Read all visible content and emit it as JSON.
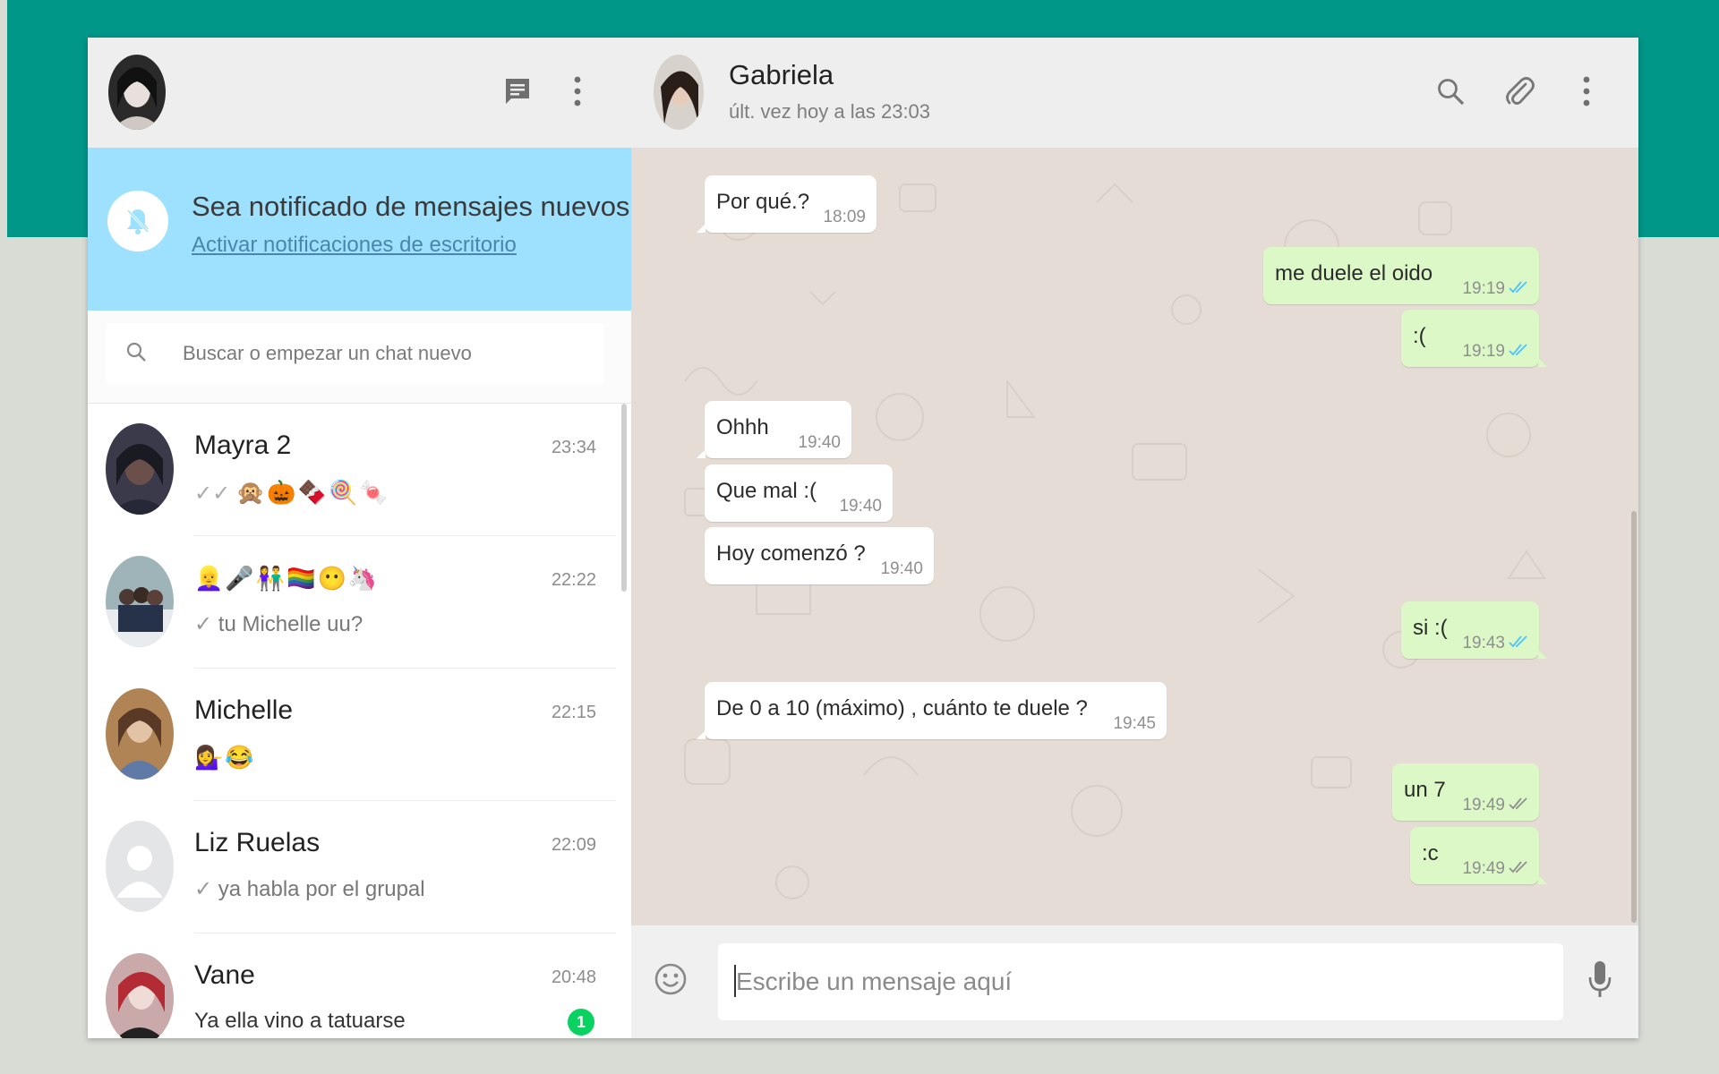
{
  "sidebar": {
    "new_chat_icon": "chat-icon",
    "menu_icon": "more-vertical-icon",
    "notification": {
      "title": "Sea notificado de mensajes nuevos",
      "link": "Activar notificaciones de escritorio",
      "icon": "bell-off-icon"
    },
    "search": {
      "placeholder": "Buscar o empezar un chat nuevo",
      "icon": "search-icon"
    },
    "chats": [
      {
        "name": "Mayra 2",
        "time": "23:34",
        "tick": "✓✓",
        "preview": "",
        "emojis": [
          "🙊",
          "🎃",
          "🍫",
          "🍭",
          "🍬"
        ],
        "unread": ""
      },
      {
        "name": "",
        "time": "22:22",
        "tick": "✓",
        "preview": "tu Michelle uu?",
        "emojis": [
          "👱‍♀️",
          "🎤",
          "👫",
          "🏳️‍🌈",
          "😶",
          "🦄"
        ],
        "unread": ""
      },
      {
        "name": "Michelle",
        "time": "22:15",
        "tick": "",
        "preview": "",
        "emojis": [
          "💁‍♀️",
          "😂"
        ],
        "unread": ""
      },
      {
        "name": "Liz Ruelas",
        "time": "22:09",
        "tick": "✓",
        "preview": "ya habla por el grupal",
        "emojis": [],
        "unread": ""
      },
      {
        "name": "Vane",
        "time": "20:48",
        "tick": "",
        "preview": "Ya ella vino a tatuarse",
        "emojis": [],
        "unread": "1"
      }
    ]
  },
  "conversation": {
    "contact_name": "Gabriela",
    "contact_status": "últ. vez hoy a las 23:03",
    "header_icons": [
      "search-icon",
      "paperclip-icon",
      "more-vertical-icon"
    ],
    "messages": [
      {
        "dir": "in",
        "text": "Por qué.?",
        "time": "18:09",
        "ticks": ""
      },
      {
        "dir": "out",
        "text": "me duele el oido",
        "time": "19:19",
        "ticks": "read"
      },
      {
        "dir": "out",
        "text": ":(",
        "time": "19:19",
        "ticks": "read"
      },
      {
        "dir": "in",
        "text": "Ohhh",
        "time": "19:40",
        "ticks": ""
      },
      {
        "dir": "in",
        "text": "Que mal :(",
        "time": "19:40",
        "ticks": ""
      },
      {
        "dir": "in",
        "text": "Hoy comenzó ?",
        "time": "19:40",
        "ticks": ""
      },
      {
        "dir": "out",
        "text": "si :(",
        "time": "19:43",
        "ticks": "read"
      },
      {
        "dir": "in",
        "text": "De 0 a 10 (máximo) , cuánto te duele ?",
        "time": "19:45",
        "ticks": ""
      },
      {
        "dir": "out",
        "text": "un 7",
        "time": "19:49",
        "ticks": "delivered"
      },
      {
        "dir": "out",
        "text": ":c",
        "time": "19:49",
        "ticks": "delivered"
      }
    ],
    "composer": {
      "placeholder": "Escribe un mensaje aquí",
      "emoji_icon": "smiley-icon",
      "mic_icon": "microphone-icon"
    }
  },
  "colors": {
    "top_band": "#009688",
    "notification_bg": "#9de1fe",
    "outgoing_bubble": "#dcf8c6",
    "read_ticks": "#4fc3f7",
    "unread_badge": "#09d261"
  }
}
